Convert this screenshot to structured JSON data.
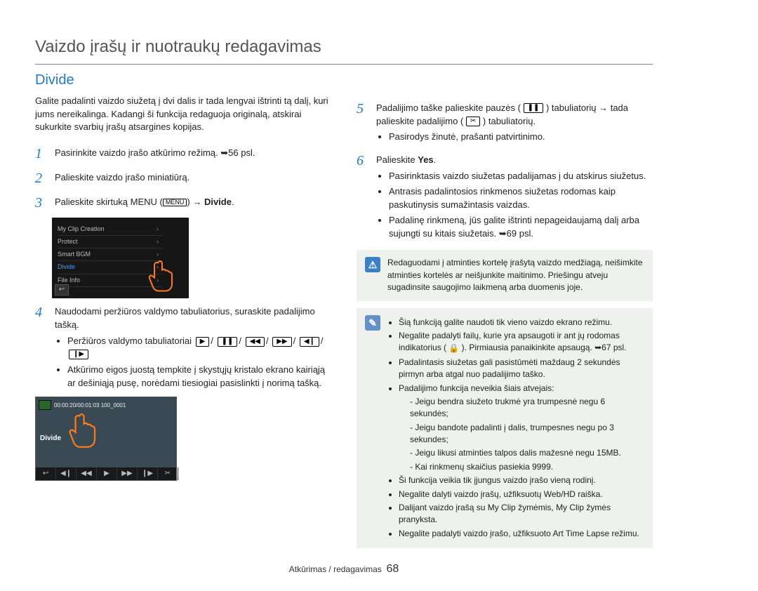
{
  "page": {
    "title": "Vaizdo įrašų ir nuotraukų redagavimas",
    "section": "Divide",
    "intro": "Galite padalinti vaizdo siužetą į dvi dalis ir tada lengvai ištrinti tą dalį, kuri jums nereikalinga. Kadangi ši funkcija redaguoja originalą, atskirai sukurkite svarbių įrašų atsargines kopijas."
  },
  "menu_labels": {
    "menu": "MENU",
    "divide": "Divide"
  },
  "steps_left": [
    "Pasirinkite vaizdo įrašo atkūrimo režimą. ➥56 psl.",
    "Palieskite vaizdo įrašo miniatiūrą.",
    "Palieskite skirtuką MENU",
    "Naudodami peržiūros valdymo tabuliatorius, suraskite padalijimo tašką."
  ],
  "step4_b1": "Peržiūros valdymo tabuliatoriai",
  "step4_b2": "Atkūrimo eigos juostą tempkite į skystųjų kristalo ekrano kairiąją ar dešiniąją pusę, norėdami tiesiogiai pasislinkti į norimą tašką.",
  "steps_right": {
    "s5a": "Padalijimo taške palieskite pauzės (",
    "s5b": ") tabuliatorių → tada palieskite padalijimo (",
    "s5c": ") tabuliatorių.",
    "s5_li": "Pasirodys žinutė, prašanti patvirtinimo.",
    "s6a": "Palieskite ",
    "s6b": "Yes",
    "s6c": ".",
    "s6_li1": "Pasirinktasis vaizdo siužetas padalijamas į du atskirus siužetus.",
    "s6_li2": "Antrasis padalintosios rinkmenos siužetas rodomas kaip paskutinysis sumažintasis vaizdas.",
    "s6_li3": "Padalinę rinkmeną, jūs galite ištrinti nepageidaujamą dalį arba sujungti su kitais siužetais. ➥69 psl."
  },
  "menu_thumb": [
    "My Clip Creation",
    "Protect",
    "Smart BGM",
    "Divide",
    "File Info"
  ],
  "video_thumb": {
    "time": "00:00:20/00:01:03  100_0001",
    "label": "Divide"
  },
  "callout_warn": "Redaguodami į atminties kortelę įrašytą vaizdo medžiagą, neišimkite atminties kortelės ar neišjunkite maitinimo. Priešingu atveju sugadinsite saugojimo laikmeną arba duomenis joje.",
  "callout_note": {
    "i1": "Šią funkciją galite naudoti tik vieno vaizdo ekrano režimu.",
    "i2a": "Negalite padalyti failų, kurie yra apsaugoti ir ant jų rodomas indikatorius (",
    "i2b": "). Pirmiausia panaikinkite apsaugą. ➥67 psl.",
    "i3": "Padalintasis siužetas gali pasistūmėti maždaug 2 sekundės pirmyn arba atgal nuo padalijimo taško.",
    "i4": "Padalijimo funkcija neveikia šiais atvejais:",
    "d1": "Jeigu bendra siužeto trukmė yra trumpesnė negu 6 sekundės;",
    "d2": "Jeigu bandote padalinti į dalis, trumpesnes negu po 3 sekundes;",
    "d3": "Jeigu likusi atminties talpos dalis mažesnė negu 15MB.",
    "d4": "Kai rinkmenų skaičius pasiekia 9999.",
    "i5": "Ši funkcija veikia tik įjungus vaizdo įrašo vieną rodinį.",
    "i6": "Negalite dalyti vaizdo įrašų, užfiksuotų Web/HD raiška.",
    "i7": "Dalijant vaizdo įrašą su My Clip žymėmis, My Clip žymės pranyksta.",
    "i8": "Negalite padalyti vaizdo įrašo, užfiksuoto Art Time Lapse režimu."
  },
  "footer": {
    "section": "Atkūrimas / redagavimas",
    "page": "68"
  }
}
